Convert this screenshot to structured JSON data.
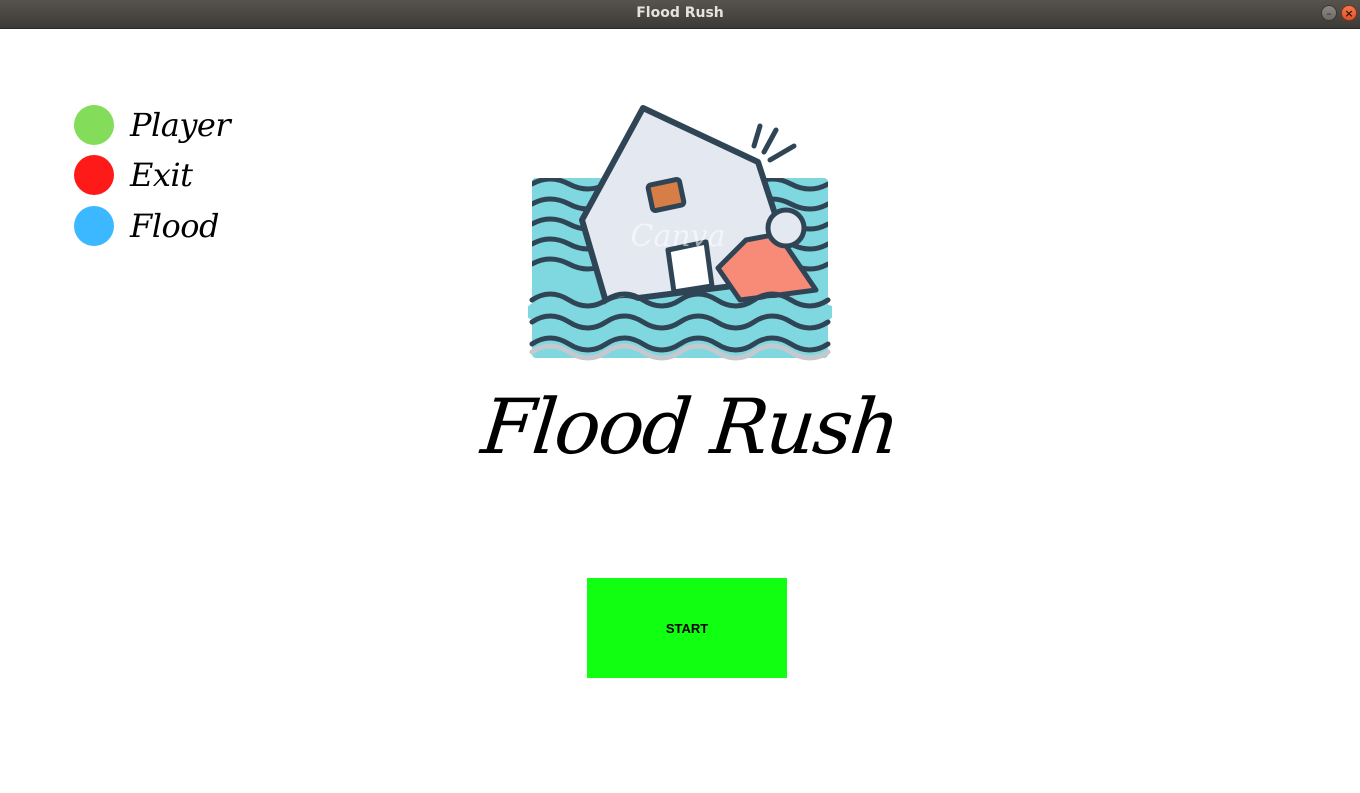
{
  "window": {
    "title": "Flood Rush",
    "minimize_glyph": "–",
    "close_glyph": "×"
  },
  "legend": [
    {
      "label": "Player",
      "color": "#83dc5a"
    },
    {
      "label": "Exit",
      "color": "#ff1a1a"
    },
    {
      "label": "Flood",
      "color": "#3bb8ff"
    }
  ],
  "logo": {
    "watermark": "Canva"
  },
  "game_title": "Flood Rush",
  "start_button": {
    "label": "START",
    "color": "#11ff11"
  }
}
